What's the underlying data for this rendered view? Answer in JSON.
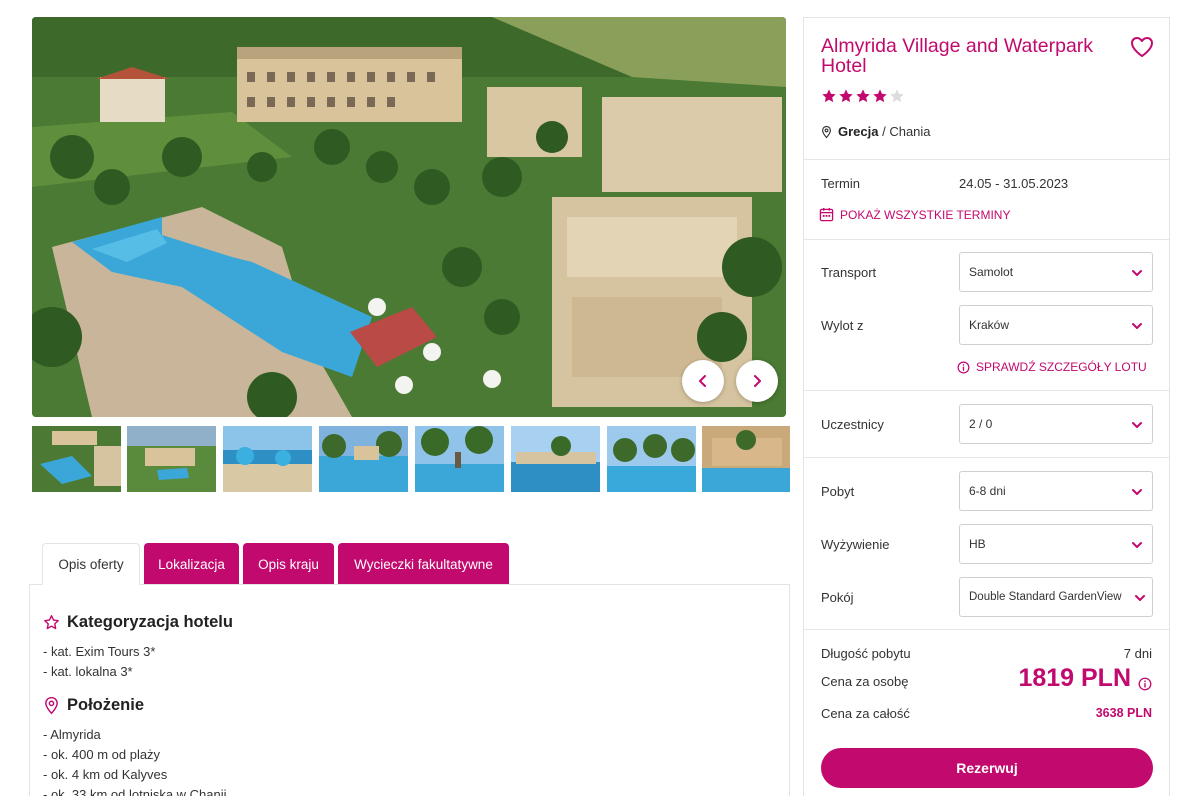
{
  "gallery": {
    "prev_icon": "chevron-left-icon",
    "next_icon": "chevron-right-icon",
    "thumbnail_count": 8
  },
  "tabs": [
    {
      "label": "Opis oferty",
      "active": true
    },
    {
      "label": "Lokalizacja",
      "active": false
    },
    {
      "label": "Opis kraju",
      "active": false
    },
    {
      "label": "Wycieczki fakultatywne",
      "active": false
    }
  ],
  "description": {
    "categorization": {
      "title": "Kategoryzacja hotelu",
      "icon": "star-outline-icon",
      "items": [
        "- kat. Exim Tours 3*",
        "- kat. lokalna 3*"
      ]
    },
    "location": {
      "title": "Położenie",
      "icon": "map-pin-icon",
      "items": [
        "- Almyrida",
        "- ok. 400 m od plaży",
        "- ok. 4 km od Kalyves",
        "- ok. 33 km od lotniska w Chanii"
      ]
    }
  },
  "hotel": {
    "name": "Almyrida Village and Waterpark Hotel",
    "rating": 4,
    "rating_max": 5,
    "country": "Grecja",
    "region_separator": " / ",
    "region": "Chania",
    "favorite_icon": "heart-outline-icon"
  },
  "term": {
    "label": "Termin",
    "value": "24.05 - 31.05.2023",
    "all_terms_link": "POKAŻ WSZYSTKIE TERMINY"
  },
  "form": {
    "transport": {
      "label": "Transport",
      "value": "Samolot"
    },
    "departure": {
      "label": "Wylot z",
      "value": "Kraków"
    },
    "flight_details_link": "SPRAWDŹ SZCZEGÓŁY LOTU",
    "participants": {
      "label": "Uczestnicy",
      "value": "2 / 0"
    },
    "stay": {
      "label": "Pobyt",
      "value": "6-8 dni"
    },
    "board": {
      "label": "Wyżywienie",
      "value": "HB"
    },
    "room": {
      "label": "Pokój",
      "value": "Double Standard GardenView"
    }
  },
  "summary": {
    "length_label": "Długość pobytu",
    "length_value": "7 dni",
    "per_person_label": "Cena za osobę",
    "per_person_value": "1819 PLN",
    "total_label": "Cena za całość",
    "total_value": "3638 PLN"
  },
  "book_button": "Rezerwuj",
  "colors": {
    "accent": "#c2096e",
    "border": "#e3e3e3"
  }
}
